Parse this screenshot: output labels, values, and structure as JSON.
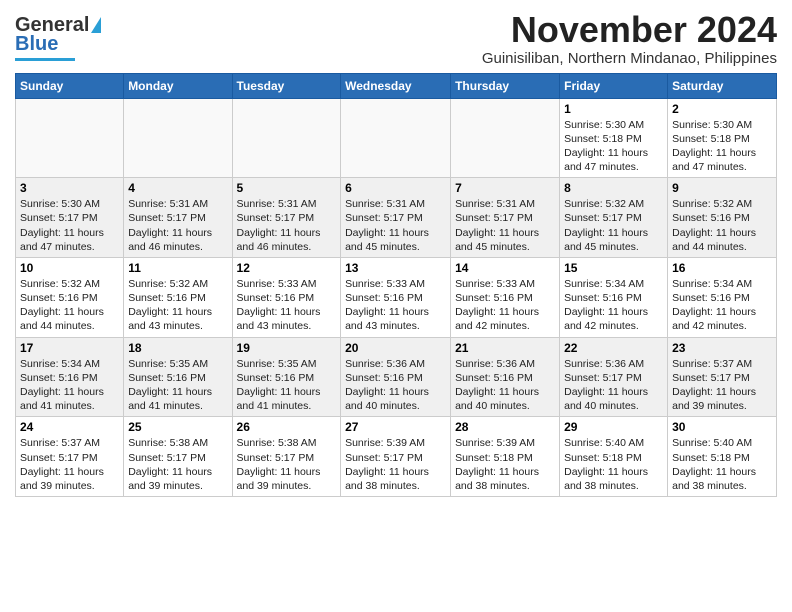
{
  "header": {
    "logo_general": "General",
    "logo_blue": "Blue",
    "title": "November 2024",
    "subtitle": "Guinisiliban, Northern Mindanao, Philippines"
  },
  "days_of_week": [
    "Sunday",
    "Monday",
    "Tuesday",
    "Wednesday",
    "Thursday",
    "Friday",
    "Saturday"
  ],
  "weeks": [
    [
      {
        "day": "",
        "info": ""
      },
      {
        "day": "",
        "info": ""
      },
      {
        "day": "",
        "info": ""
      },
      {
        "day": "",
        "info": ""
      },
      {
        "day": "",
        "info": ""
      },
      {
        "day": "1",
        "info": "Sunrise: 5:30 AM\nSunset: 5:18 PM\nDaylight: 11 hours\nand 47 minutes."
      },
      {
        "day": "2",
        "info": "Sunrise: 5:30 AM\nSunset: 5:18 PM\nDaylight: 11 hours\nand 47 minutes."
      }
    ],
    [
      {
        "day": "3",
        "info": "Sunrise: 5:30 AM\nSunset: 5:17 PM\nDaylight: 11 hours\nand 47 minutes."
      },
      {
        "day": "4",
        "info": "Sunrise: 5:31 AM\nSunset: 5:17 PM\nDaylight: 11 hours\nand 46 minutes."
      },
      {
        "day": "5",
        "info": "Sunrise: 5:31 AM\nSunset: 5:17 PM\nDaylight: 11 hours\nand 46 minutes."
      },
      {
        "day": "6",
        "info": "Sunrise: 5:31 AM\nSunset: 5:17 PM\nDaylight: 11 hours\nand 45 minutes."
      },
      {
        "day": "7",
        "info": "Sunrise: 5:31 AM\nSunset: 5:17 PM\nDaylight: 11 hours\nand 45 minutes."
      },
      {
        "day": "8",
        "info": "Sunrise: 5:32 AM\nSunset: 5:17 PM\nDaylight: 11 hours\nand 45 minutes."
      },
      {
        "day": "9",
        "info": "Sunrise: 5:32 AM\nSunset: 5:16 PM\nDaylight: 11 hours\nand 44 minutes."
      }
    ],
    [
      {
        "day": "10",
        "info": "Sunrise: 5:32 AM\nSunset: 5:16 PM\nDaylight: 11 hours\nand 44 minutes."
      },
      {
        "day": "11",
        "info": "Sunrise: 5:32 AM\nSunset: 5:16 PM\nDaylight: 11 hours\nand 43 minutes."
      },
      {
        "day": "12",
        "info": "Sunrise: 5:33 AM\nSunset: 5:16 PM\nDaylight: 11 hours\nand 43 minutes."
      },
      {
        "day": "13",
        "info": "Sunrise: 5:33 AM\nSunset: 5:16 PM\nDaylight: 11 hours\nand 43 minutes."
      },
      {
        "day": "14",
        "info": "Sunrise: 5:33 AM\nSunset: 5:16 PM\nDaylight: 11 hours\nand 42 minutes."
      },
      {
        "day": "15",
        "info": "Sunrise: 5:34 AM\nSunset: 5:16 PM\nDaylight: 11 hours\nand 42 minutes."
      },
      {
        "day": "16",
        "info": "Sunrise: 5:34 AM\nSunset: 5:16 PM\nDaylight: 11 hours\nand 42 minutes."
      }
    ],
    [
      {
        "day": "17",
        "info": "Sunrise: 5:34 AM\nSunset: 5:16 PM\nDaylight: 11 hours\nand 41 minutes."
      },
      {
        "day": "18",
        "info": "Sunrise: 5:35 AM\nSunset: 5:16 PM\nDaylight: 11 hours\nand 41 minutes."
      },
      {
        "day": "19",
        "info": "Sunrise: 5:35 AM\nSunset: 5:16 PM\nDaylight: 11 hours\nand 41 minutes."
      },
      {
        "day": "20",
        "info": "Sunrise: 5:36 AM\nSunset: 5:16 PM\nDaylight: 11 hours\nand 40 minutes."
      },
      {
        "day": "21",
        "info": "Sunrise: 5:36 AM\nSunset: 5:16 PM\nDaylight: 11 hours\nand 40 minutes."
      },
      {
        "day": "22",
        "info": "Sunrise: 5:36 AM\nSunset: 5:17 PM\nDaylight: 11 hours\nand 40 minutes."
      },
      {
        "day": "23",
        "info": "Sunrise: 5:37 AM\nSunset: 5:17 PM\nDaylight: 11 hours\nand 39 minutes."
      }
    ],
    [
      {
        "day": "24",
        "info": "Sunrise: 5:37 AM\nSunset: 5:17 PM\nDaylight: 11 hours\nand 39 minutes."
      },
      {
        "day": "25",
        "info": "Sunrise: 5:38 AM\nSunset: 5:17 PM\nDaylight: 11 hours\nand 39 minutes."
      },
      {
        "day": "26",
        "info": "Sunrise: 5:38 AM\nSunset: 5:17 PM\nDaylight: 11 hours\nand 39 minutes."
      },
      {
        "day": "27",
        "info": "Sunrise: 5:39 AM\nSunset: 5:17 PM\nDaylight: 11 hours\nand 38 minutes."
      },
      {
        "day": "28",
        "info": "Sunrise: 5:39 AM\nSunset: 5:18 PM\nDaylight: 11 hours\nand 38 minutes."
      },
      {
        "day": "29",
        "info": "Sunrise: 5:40 AM\nSunset: 5:18 PM\nDaylight: 11 hours\nand 38 minutes."
      },
      {
        "day": "30",
        "info": "Sunrise: 5:40 AM\nSunset: 5:18 PM\nDaylight: 11 hours\nand 38 minutes."
      }
    ]
  ]
}
